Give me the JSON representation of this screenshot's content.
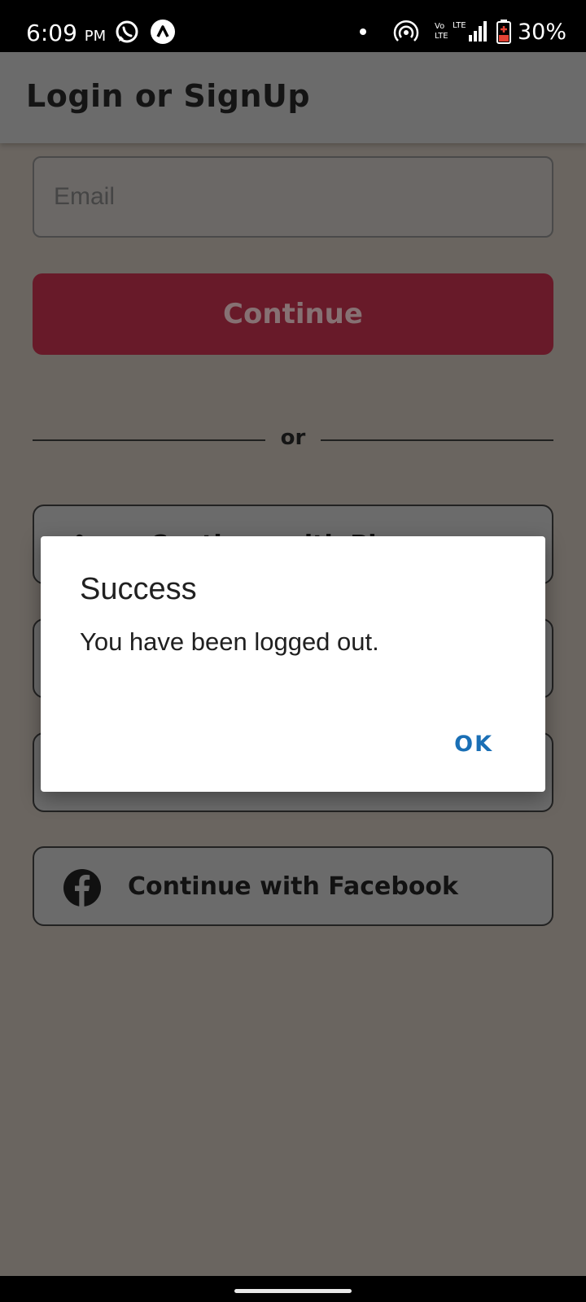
{
  "status_bar": {
    "time": "6:09",
    "ampm": "PM",
    "battery": "30%",
    "icons": [
      "whatsapp-icon",
      "app-icon",
      "dot-icon",
      "hotspot-icon",
      "volte-icon",
      "lte-signal-icon",
      "battery-icon"
    ]
  },
  "app_bar": {
    "title": "Login or SignUp"
  },
  "form": {
    "email_placeholder": "Email",
    "email_value": "",
    "continue_label": "Continue",
    "divider_text": "or"
  },
  "social_buttons": [
    {
      "label": "Continue with Phone",
      "icon": "phone-icon"
    },
    {
      "label": "",
      "icon": ""
    },
    {
      "label": "",
      "icon": ""
    },
    {
      "label": "Continue with Facebook",
      "icon": "facebook-icon"
    }
  ],
  "dialog": {
    "title": "Success",
    "message": "You have been logged out.",
    "ok_label": "OK"
  },
  "colors": {
    "continue_button": "#681a29",
    "dialog_accent": "#1a6fb5",
    "scrim_background": "#6a6560"
  }
}
